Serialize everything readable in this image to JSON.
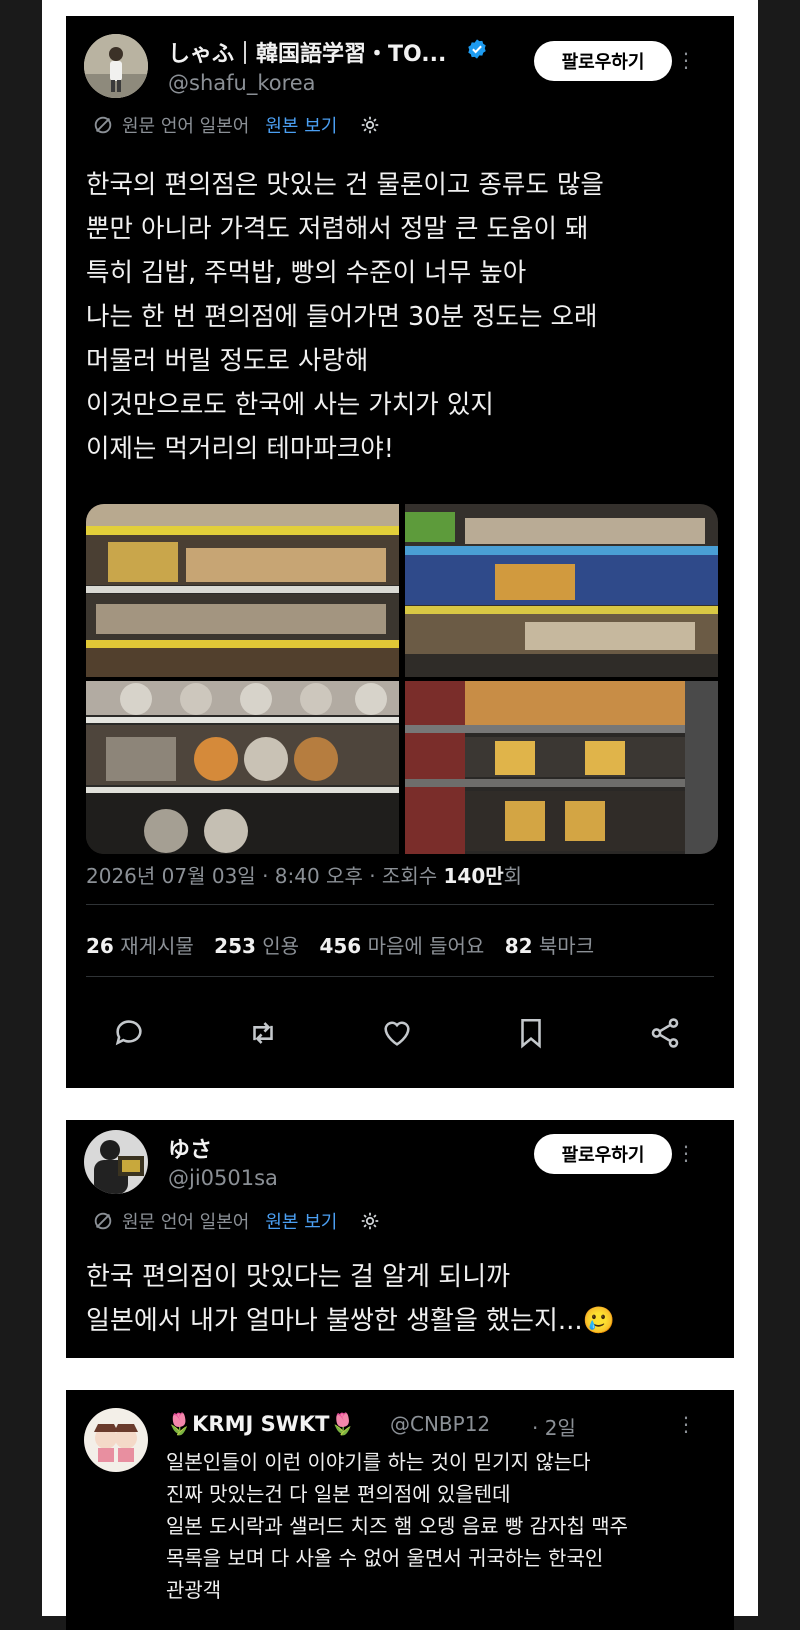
{
  "post": {
    "display_name": "しゃふ｜韓国語学習・TO...",
    "handle": "@shafu_korea",
    "follow_label": "팔로우하기",
    "translate_label": "원문 언어 일본어",
    "original_link": "원본 보기",
    "lines": [
      "한국의 편의점은 맛있는 건 물론이고 종류도 많을",
      "뿐만 아니라 가격도 저렴해서 정말 큰 도움이 돼",
      "특히 김밥, 주먹밥, 빵의 수준이 너무 높아",
      "나는 한 번 편의점에 들어가면 30분 정도는 오래",
      "머물러 버릴 정도로 사랑해",
      "이것만으로도 한국에 사는 가치가 있지",
      "이제는 먹거리의 테마파크야!"
    ],
    "datetime": "2026년 07월 03일 · 8:40 오후 · 조회수 ",
    "views_number": "140만",
    "views_suffix": "회",
    "stats": {
      "reposts_count": "26",
      "reposts_label": "재게시물",
      "quotes_count": "253",
      "quotes_label": "인용",
      "likes_count": "456",
      "likes_label": "마음에 들어요",
      "bookmarks_count": "82",
      "bookmarks_label": "북마크"
    },
    "more_glyph": "⋮"
  },
  "reply1": {
    "display_name": "ゆさ",
    "handle": "@ji0501sa",
    "follow_label": "팔로우하기",
    "translate_label": "원문 언어 일본어",
    "original_link": "원본 보기",
    "lines": [
      "한국 편의점이 맛있다는 걸 알게 되니까",
      "일본에서 내가 얼마나 불쌍한 생활을 했는지...🥲"
    ],
    "more_glyph": "⋮"
  },
  "reply2": {
    "display_name": "🌷KRMJ SWKT🌷",
    "handle": "@CNBP12",
    "time": "· 2일",
    "lines": [
      "일본인들이 이런 이야기를 하는 것이 믿기지 않는다",
      "진짜 맛있는건 다 일본 편의점에 있을텐데",
      "일본 도시락과 샐러드 치즈 햄 오뎅 음료 빵 감자칩 맥주",
      "목록을 보며 다 사올 수 없어 울면서 귀국하는 한국인",
      "관광객"
    ],
    "more_glyph": "⋮"
  },
  "colors": {
    "accent": "#1d9bf0",
    "link": "#4b9ff2",
    "background": "#000000",
    "muted": "#8b9096"
  }
}
